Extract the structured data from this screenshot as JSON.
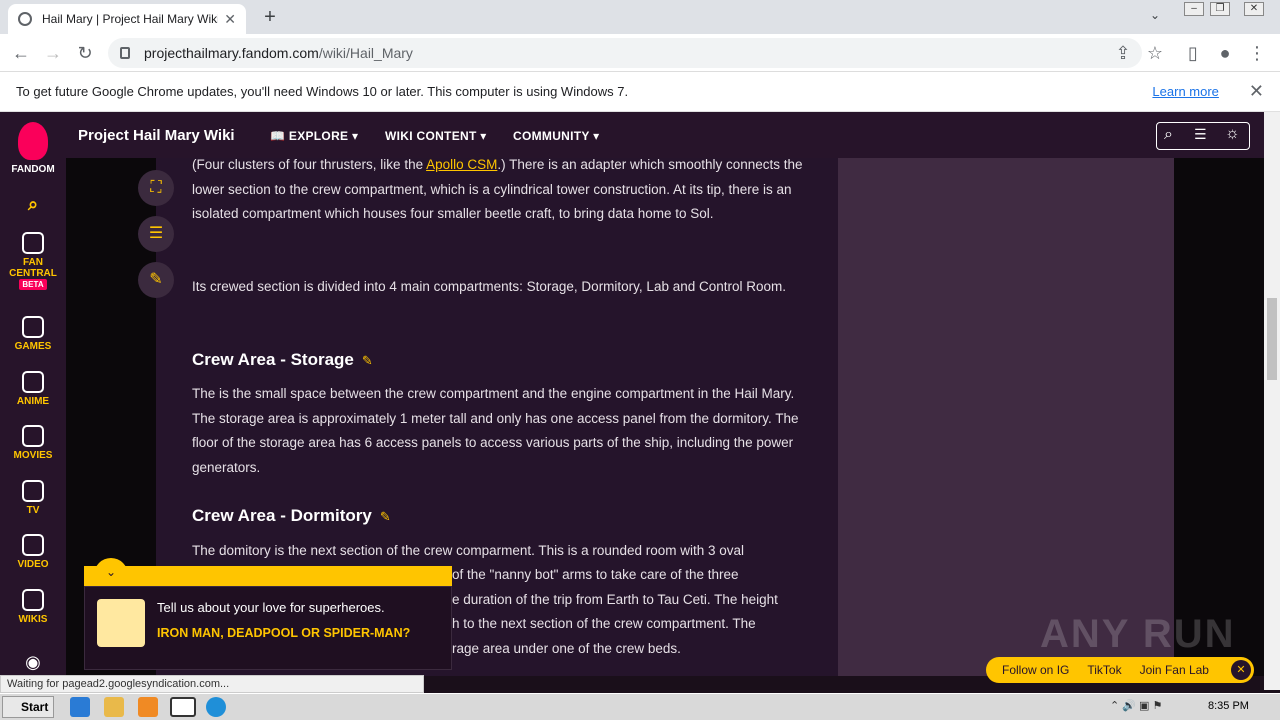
{
  "browser": {
    "tab_title": "Hail Mary | Project Hail Mary Wiki | F",
    "url_host": "projecthailmary.fandom.com",
    "url_path": "/wiki/Hail_Mary",
    "infobar_message": "To get future Google Chrome updates, you'll need Windows 10 or later. This computer is using Windows 7.",
    "infobar_link": "Learn more",
    "status_text": "Waiting for pagead2.googlesyndication.com..."
  },
  "rail": {
    "fandom": "FANDOM",
    "fan_central": "FAN CENTRAL",
    "beta": "BETA",
    "games": "GAMES",
    "anime": "ANIME",
    "movies": "MOVIES",
    "tv": "TV",
    "video": "VIDEO",
    "wikis": "WIKIS"
  },
  "site": {
    "title": "Project Hail Mary Wiki",
    "nav": [
      "EXPLORE",
      "WIKI CONTENT",
      "COMMUNITY"
    ]
  },
  "article": {
    "p1_before": "(Four clusters of four thrusters, like the ",
    "p1_link": "Apollo CSM",
    "p1_after": ".) There is an adapter which smoothly connects the lower section to the crew compartment, which is a cylindrical tower construction. At its tip, there is an isolated compartment which houses four smaller beetle craft, to bring data home to Sol.",
    "p2": "Its crewed section is divided into 4 main compartments: Storage, Dormitory, Lab and Control Room.",
    "h_storage": "Crew Area - Storage",
    "p3": "The is the small space between the crew compartment and the engine compartment in the Hail Mary. The storage area is approximately 1 meter tall and only has one access panel from the dormitory. The floor of the storage area has 6 access panels to access various parts of the ship, including the power generators.",
    "h_dorm": "Crew Area - Dormitory",
    "p4_line1": "The domitory is the next section of the crew comparment. This is a rounded room with 3 oval",
    "p4_line2": "of the \"nanny bot\" arms to take care of the three",
    "p4_line3": "e duration of the trip from Earth to Tau Ceti. The height",
    "p4_line4": "h to the next section of the crew compartment. The",
    "p4_line5": "rage area under one of the crew beds."
  },
  "popup": {
    "question": "Tell us about your love for superheroes.",
    "answer": "IRON MAN, DEADPOOL OR SPIDER-MAN?"
  },
  "follow": {
    "ig": "Follow on IG",
    "tiktok": "TikTok",
    "fanlab": "Join Fan Lab"
  },
  "watermark": "ANY RUN",
  "taskbar": {
    "start": "Start",
    "time": "8:35 PM"
  },
  "colors": {
    "accent": "#ffc500",
    "site_bg": "#27142a",
    "content_bg": "#25142b"
  }
}
